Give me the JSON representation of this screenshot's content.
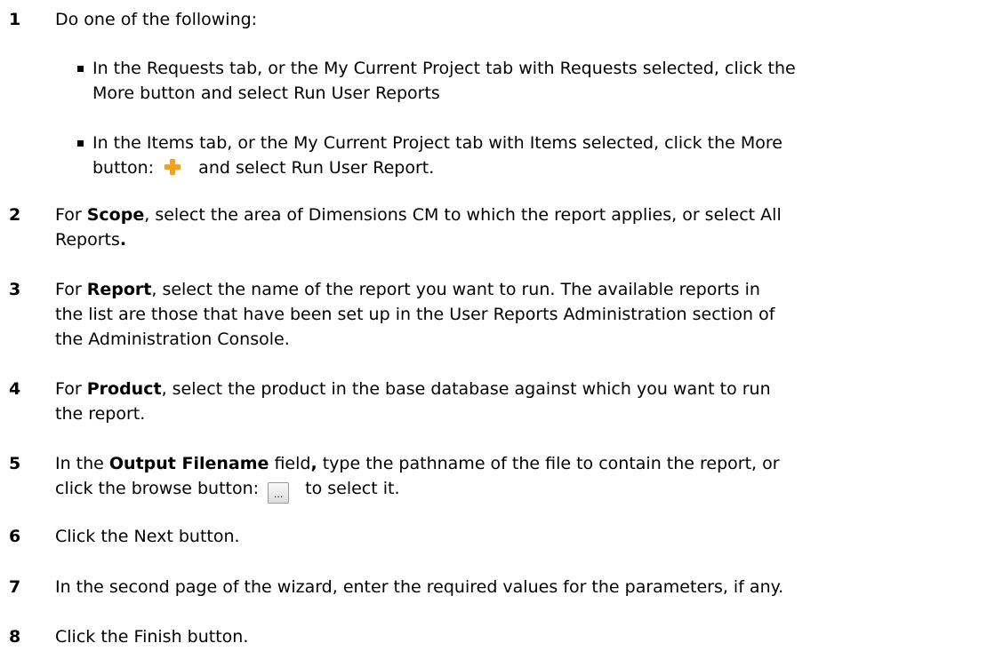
{
  "steps": [
    {
      "number": "1",
      "text": "Do one of the following:",
      "bullets": [
        {
          "line1": "In the Requests tab, or the My Current Project tab with Requests selected, click the",
          "line2": "More button and select Run User Reports"
        },
        {
          "line1": "In the Items tab, or the My Current Project tab with Items selected, click the More",
          "line2_before": "button:",
          "line2_after": "and select Run User Report."
        }
      ]
    },
    {
      "number": "2",
      "pre": "For ",
      "bold": "Scope",
      "line1_rest": ", select the area of Dimensions CM to which the report applies, or select All",
      "line2": "Reports",
      "line2_bold": "."
    },
    {
      "number": "3",
      "pre": "For ",
      "bold": "Report",
      "line1_rest": ", select the name of the report you want to run. The available reports in",
      "line2": "the list are those that have been set up in the User Reports Administration section of",
      "line3": "the Administration Console."
    },
    {
      "number": "4",
      "pre": "For ",
      "bold": "Product",
      "line1_rest": ", select the product in the base database against which you want to run",
      "line2": "the report."
    },
    {
      "number": "5",
      "pre": "In the ",
      "bold": "Output Filename",
      "mid": " field",
      "bold2": ",",
      "line1_rest": " type the pathname of the file to contain the report, or",
      "line2_before": "click the browse button:",
      "button_label": "...",
      "line2_after": "to select it."
    },
    {
      "number": "6",
      "text": "Click the Next button."
    },
    {
      "number": "7",
      "text": "In the second page of the wizard, enter the required values for the parameters, if any."
    },
    {
      "number": "8",
      "text": "Click the Finish button."
    }
  ],
  "colors": {
    "plus_icon": "#f5a020"
  },
  "icons": {
    "more_button": "plus-icon",
    "browse_button": "ellipsis-button"
  }
}
